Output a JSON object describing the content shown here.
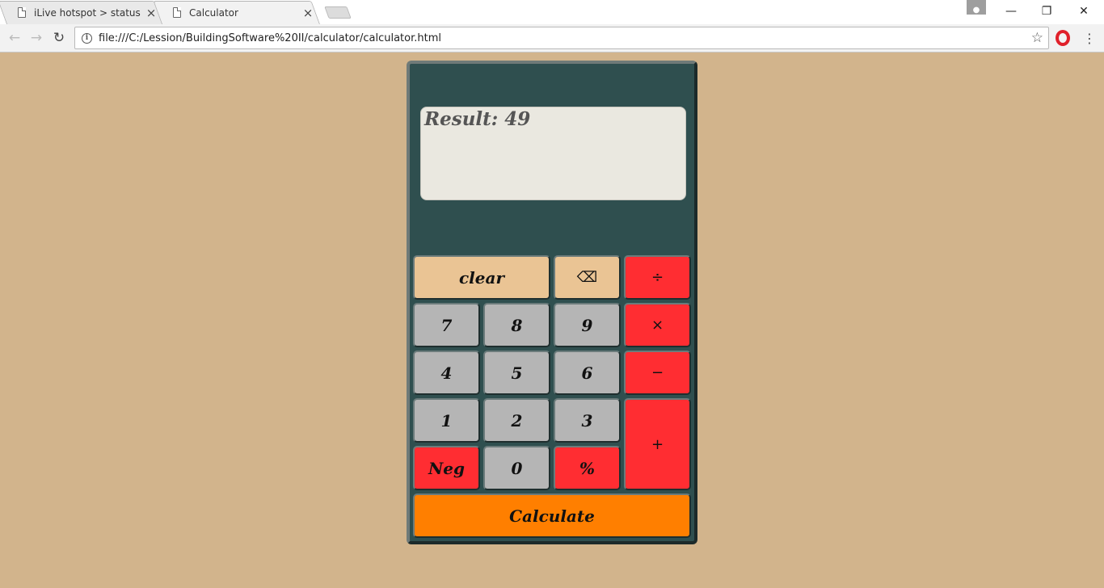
{
  "browser": {
    "tabs": [
      {
        "title": "iLive hotspot > status",
        "active": false
      },
      {
        "title": "Calculator",
        "active": true
      }
    ],
    "close_glyph": "×",
    "url": "file:///C:/Lession/BuildingSoftware%20II/calculator/calculator.html",
    "window_controls": {
      "minimize": "—",
      "restore": "❐",
      "close": "✕"
    }
  },
  "calculator": {
    "result_text": "Result: 49",
    "keys": {
      "clear": "clear",
      "backspace": "⌫",
      "divide": "÷",
      "multiply": "×",
      "subtract": "−",
      "add": "+",
      "seven": "7",
      "eight": "8",
      "nine": "9",
      "four": "4",
      "five": "5",
      "six": "6",
      "one": "1",
      "two": "2",
      "three": "3",
      "neg": "Neg",
      "zero": "0",
      "percent": "%",
      "calculate": "Calculate"
    },
    "colors": {
      "page_background": "#d2b48c",
      "calculator_body": "#2f4f4f",
      "display_background": "#eae8e0",
      "number_key": "#b5b5b5",
      "function_key": "#eac494",
      "operator_key": "#ff2d32",
      "calculate_key": "#ff7f00"
    }
  }
}
